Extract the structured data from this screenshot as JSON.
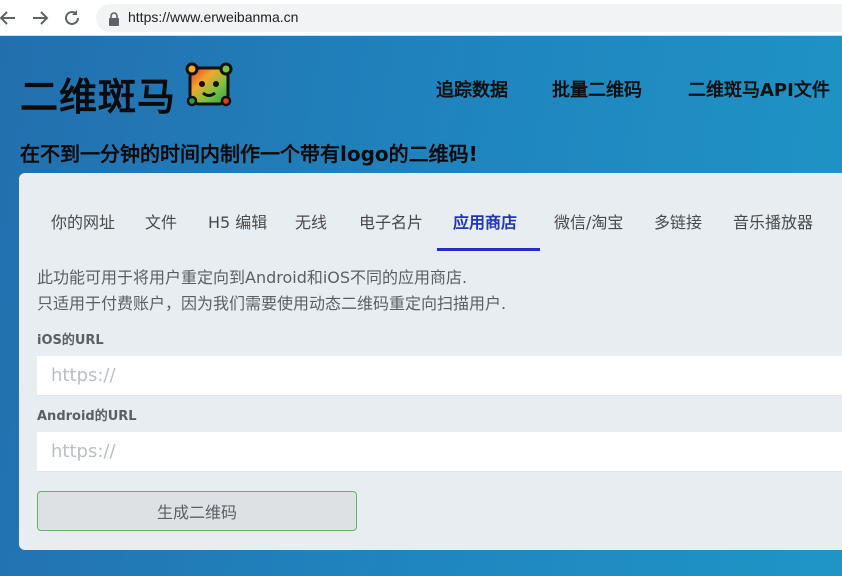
{
  "browser": {
    "url": "https://www.erweibanma.cn"
  },
  "header": {
    "logo_text": "二维斑马",
    "nav": [
      {
        "label": "追踪数据"
      },
      {
        "label": "批量二维码"
      },
      {
        "label": "二维斑马API文件"
      }
    ],
    "tagline": "在不到一分钟的时间内制作一个带有logo的二维码!"
  },
  "tabs": [
    {
      "label": "你的网址"
    },
    {
      "label": "文件"
    },
    {
      "label": "H5 编辑"
    },
    {
      "label": "无线"
    },
    {
      "label": "电子名片"
    },
    {
      "label": "应用商店",
      "active": true
    },
    {
      "label": "微信/淘宝"
    },
    {
      "label": "多链接"
    },
    {
      "label": "音乐播放器"
    }
  ],
  "form": {
    "description_line1": "此功能可用于将用户重定向到Android和iOS不同的应用商店.",
    "description_line2": "只适用于付费账户，因为我们需要使用动态二维码重定向扫描用户.",
    "ios_label": "iOS的URL",
    "ios_placeholder": "https://",
    "android_label": "Android的URL",
    "android_placeholder": "https://",
    "submit_label": "生成二维码"
  },
  "colors": {
    "accent_tab": "#2237b8",
    "button_border": "#66b26a"
  }
}
